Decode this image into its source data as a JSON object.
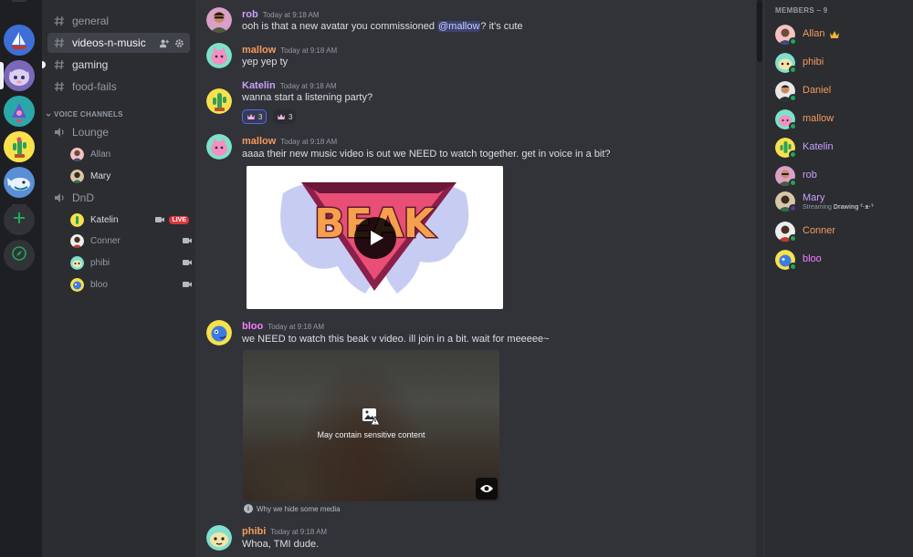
{
  "servers": [
    {
      "name": "sailboat-server",
      "color": "#3d6fd6"
    },
    {
      "name": "cat-server",
      "color": "#6b5ca5"
    },
    {
      "name": "bird-server",
      "color": "#2d9c9c"
    },
    {
      "name": "cactus-server",
      "color": "#f6e05e"
    },
    {
      "name": "whale-server",
      "color": "#2c5e7a"
    }
  ],
  "rail_actions": {
    "add": "add-server-icon",
    "explore": "compass-icon"
  },
  "channels": {
    "text": [
      {
        "label": "general"
      },
      {
        "label": "videos-n-music",
        "selected": true
      },
      {
        "label": "gaming",
        "unread": true
      },
      {
        "label": "food-fails"
      }
    ],
    "voice_header": "VOICE CHANNELS",
    "voice": [
      {
        "label": "Lounge",
        "users": [
          {
            "name": "Allan"
          },
          {
            "name": "Mary"
          }
        ]
      },
      {
        "label": "DnD",
        "users": [
          {
            "name": "Katelin",
            "live": "LIVE"
          },
          {
            "name": "Conner"
          },
          {
            "name": "phibi"
          },
          {
            "name": "bloo"
          }
        ]
      }
    ]
  },
  "messages": [
    {
      "author": "rob",
      "color": "#c9a0fc",
      "time": "Today at 9:18 AM",
      "text_before": "ooh is that a new avatar you commissioned ",
      "mention": "@mallow",
      "text_after": "? it's cute"
    },
    {
      "author": "mallow",
      "color": "#f69a5c",
      "time": "Today at 9:18 AM",
      "text": "yep yep ty"
    },
    {
      "author": "Katelin",
      "color": "#c9a0fc",
      "time": "Today at 9:18 AM",
      "text": "wanna start a listening party?",
      "reactions": [
        {
          "count": "3",
          "me": true
        },
        {
          "count": "3",
          "me": false
        }
      ]
    },
    {
      "author": "mallow",
      "color": "#f69a5c",
      "time": "Today at 9:18 AM",
      "text": "aaaa their new music video is out we NEED to watch together. get in voice in a bit?",
      "embed_logo": "BEAK"
    },
    {
      "author": "bloo",
      "color": "#f47fff",
      "time": "Today at 9:18 AM",
      "text": "we NEED to watch this beak v video. ill join in a bit. wait for meeeee~",
      "sensitive_text": "May contain sensitive content",
      "why_text": "Why we hide some media"
    },
    {
      "author": "phibi",
      "color": "#f69a5c",
      "time": "Today at 9:18 AM",
      "text": "Whoa, TMI dude."
    }
  ],
  "members": {
    "header": "MEMBERS – 9",
    "list": [
      {
        "name": "Allan",
        "color": "#f69a5c",
        "crown": true
      },
      {
        "name": "phibi",
        "color": "#f69a5c"
      },
      {
        "name": "Daniel",
        "color": "#f69a5c"
      },
      {
        "name": "mallow",
        "color": "#f69a5c"
      },
      {
        "name": "Katelin",
        "color": "#c9a0fc"
      },
      {
        "name": "rob",
        "color": "#c9a0fc"
      },
      {
        "name": "Mary",
        "color": "#c9a0fc",
        "activity_prefix": "Streaming",
        "activity_bold": "Drawing ˁ·ᴥ·ˀ"
      },
      {
        "name": "Conner",
        "color": "#f69a5c"
      },
      {
        "name": "bloo",
        "color": "#f47fff"
      }
    ]
  }
}
